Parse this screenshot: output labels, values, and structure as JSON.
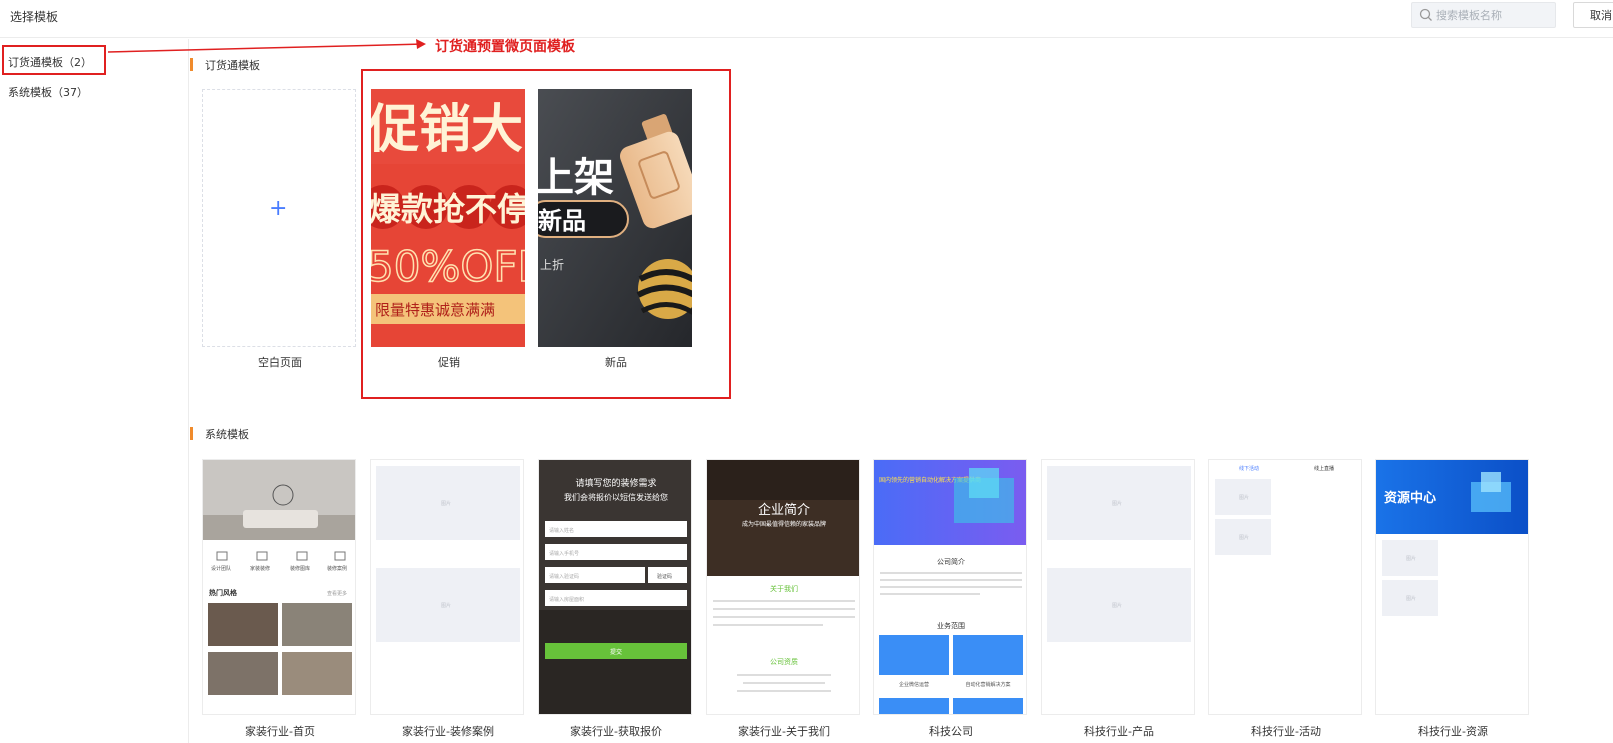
{
  "header": {
    "title": "选择模板",
    "search_placeholder": "搜索模板名称",
    "cancel_label": "取消"
  },
  "sidebar": {
    "items": [
      {
        "label": "订货通模板（2）"
      },
      {
        "label": "系统模板（37）"
      }
    ]
  },
  "annotation": {
    "text": "订货通预置微页面模板"
  },
  "sections": [
    {
      "title": "订货通模板",
      "cards": [
        {
          "label": "空白页面",
          "icon": "plus-icon"
        },
        {
          "label": "促销",
          "poster_lines": [
            "促销大",
            "爆款抢不停",
            "50%OFF",
            "限量特惠诚意满满"
          ]
        },
        {
          "label": "新品",
          "poster_lines": [
            "上架",
            "新品",
            "上折"
          ]
        }
      ]
    },
    {
      "title": "系统模板",
      "cards": [
        {
          "label": "家装行业-首页",
          "menu": [
            "设计团队",
            "家装装修",
            "装修图库",
            "装修案例"
          ],
          "section": "热门风格",
          "more": "查看更多"
        },
        {
          "label": "家装行业-装修案例",
          "ph": [
            "图片",
            "图片"
          ]
        },
        {
          "label": "家装行业-获取报价",
          "title1": "请填写您的装修需求",
          "title2": "我们会将报价以短信发送给您",
          "fields": [
            "请输入姓名",
            "请输入手机号",
            "请输入验证码",
            "请输入房屋面积"
          ],
          "code_btn": "验证码",
          "submit": "提交"
        },
        {
          "label": "家装行业-关于我们",
          "hero1": "企业简介",
          "hero2": "成为中国最值得信赖的家装品牌",
          "about": "关于我们",
          "qual": "公司资质"
        },
        {
          "label": "科技公司",
          "banner": "国内领先的营销自动化解决方案提供商",
          "intro": "公司简介",
          "scope": "业务范围",
          "svc1": "企业微信运营",
          "svc2": "自动化营销解决方案"
        },
        {
          "label": "科技行业-产品",
          "ph": [
            "图片",
            "图片"
          ]
        },
        {
          "label": "科技行业-活动",
          "tabs": [
            "线下活动",
            "线上直播"
          ],
          "ph": [
            "图片",
            "图片"
          ]
        },
        {
          "label": "科技行业-资源",
          "banner": "资源中心",
          "ph": [
            "图片",
            "图片"
          ]
        }
      ]
    }
  ],
  "colors": {
    "accent": "#4a7dff",
    "annotation": "#e02020",
    "section_bar": "#f08b2c",
    "green": "#67c23a"
  }
}
